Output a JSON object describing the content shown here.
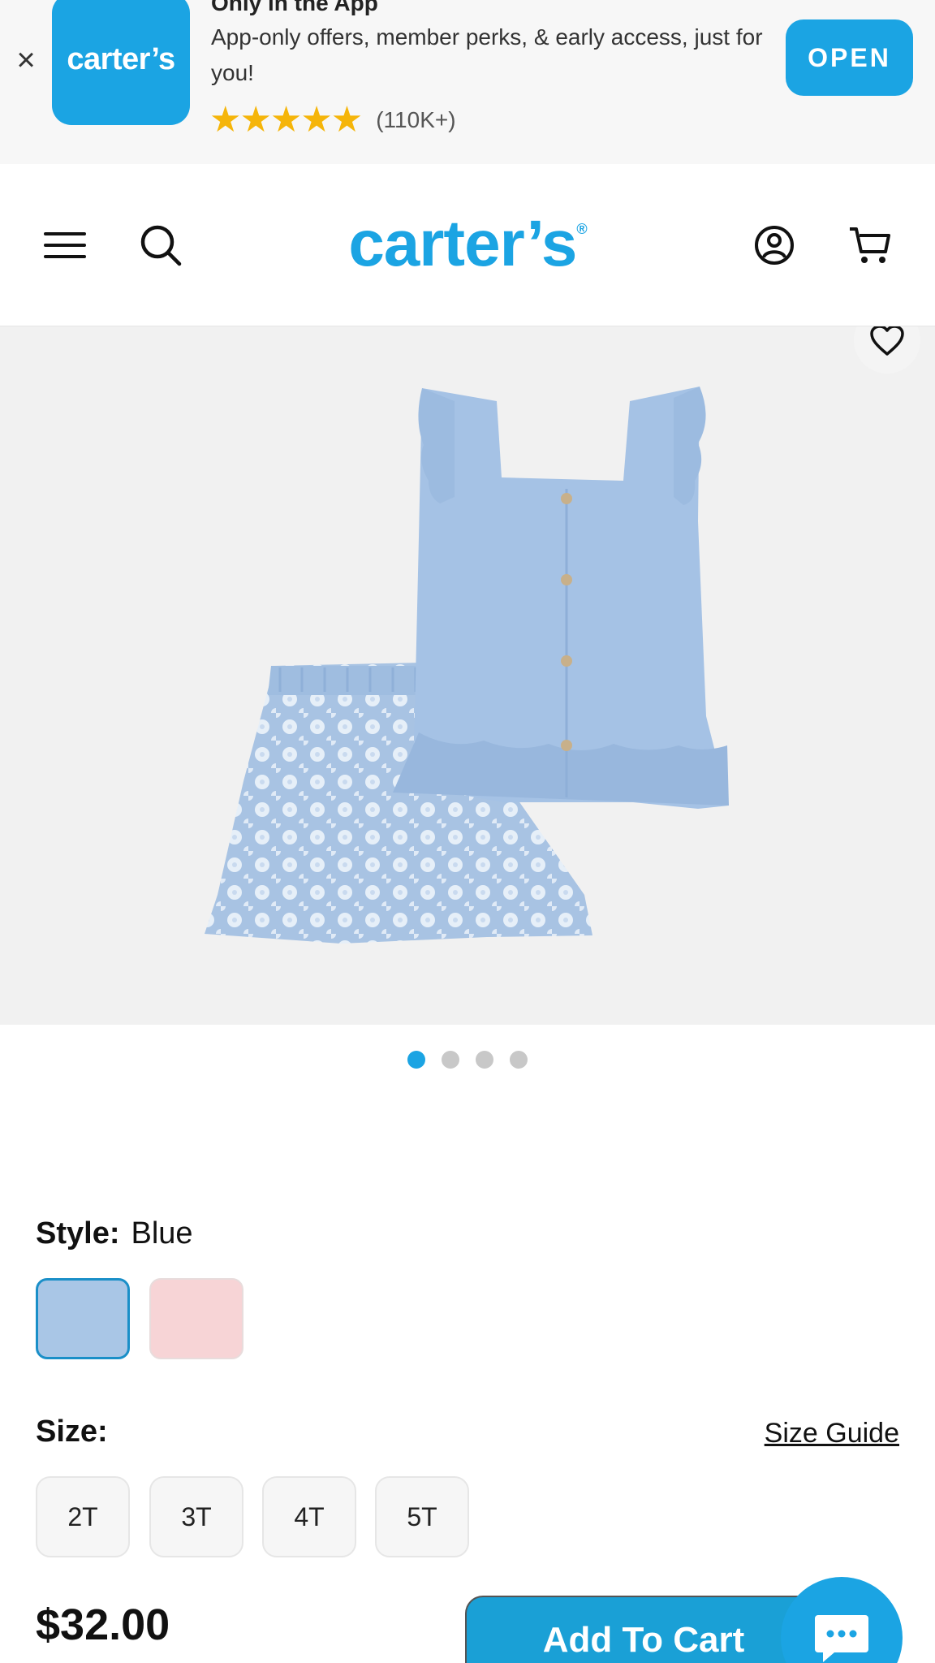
{
  "app_banner": {
    "close_icon": "close-icon",
    "app_icon_text": "carter’s",
    "title": "Only in the App",
    "description": "App-only offers, member perks, & early access, just for you!",
    "stars": "★★★★★",
    "rating_count": "(110K+)",
    "open_label": "OPEN"
  },
  "header": {
    "menu_icon": "hamburger-menu-icon",
    "search_icon": "search-icon",
    "logo_text": "carter’s",
    "logo_mark": "®",
    "account_icon": "account-icon",
    "cart_icon": "cart-icon"
  },
  "gallery": {
    "favorite_icon": "heart-icon",
    "dots_count": 4,
    "active_dot": 0
  },
  "product": {
    "style_label": "Style:",
    "style_value": "Blue",
    "swatches": [
      "Blue",
      "Pink"
    ],
    "size_label": "Size:",
    "size_guide": "Size Guide",
    "sizes": [
      "2T",
      "3T",
      "4T",
      "5T"
    ],
    "price": "$32.00",
    "add_to_cart": "Add To Cart"
  },
  "chat": {
    "icon": "chat-icon"
  },
  "colors": {
    "brand_blue": "#1ba4e3",
    "swatch_blue": "#a9c6e6",
    "swatch_pink": "#f7d4d6",
    "star_gold": "#f5b50a"
  }
}
